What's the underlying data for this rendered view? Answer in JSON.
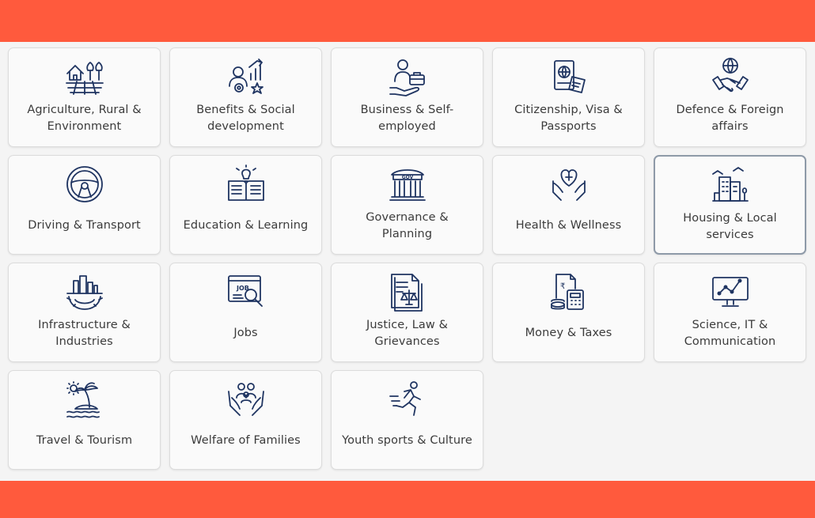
{
  "colors": {
    "accent": "#ff5a3d",
    "icon": "#1f3461",
    "text": "#3b3b3b",
    "tile_bg": "#fafafa"
  },
  "categories": [
    {
      "label": "Agriculture, Rural & Environment",
      "icon": "farm-icon"
    },
    {
      "label": "Benefits & Social development",
      "icon": "social-benefits-icon"
    },
    {
      "label": "Business & Self-employed",
      "icon": "businessman-briefcase-icon"
    },
    {
      "label": "Citizenship, Visa & Passports",
      "icon": "passport-icon"
    },
    {
      "label": "Defence & Foreign affairs",
      "icon": "handshake-globe-icon"
    },
    {
      "label": "Driving & Transport",
      "icon": "steering-wheel-icon"
    },
    {
      "label": "Education & Learning",
      "icon": "book-bulb-icon"
    },
    {
      "label": "Governance & Planning",
      "icon": "government-building-icon"
    },
    {
      "label": "Health & Wellness",
      "icon": "heart-hands-icon"
    },
    {
      "label": "Housing & Local services",
      "icon": "buildings-icon",
      "selected": true
    },
    {
      "label": "Infrastructure & Industries",
      "icon": "industry-gear-icon"
    },
    {
      "label": "Jobs",
      "icon": "job-search-icon"
    },
    {
      "label": "Justice, Law & Grievances",
      "icon": "law-document-scales-icon"
    },
    {
      "label": "Money & Taxes",
      "icon": "calculator-rupee-icon"
    },
    {
      "label": "Science, IT & Communication",
      "icon": "computer-network-icon"
    },
    {
      "label": "Travel & Tourism",
      "icon": "island-palm-icon"
    },
    {
      "label": "Welfare of Families",
      "icon": "family-hands-icon"
    },
    {
      "label": "Youth sports & Culture",
      "icon": "runner-icon"
    }
  ]
}
